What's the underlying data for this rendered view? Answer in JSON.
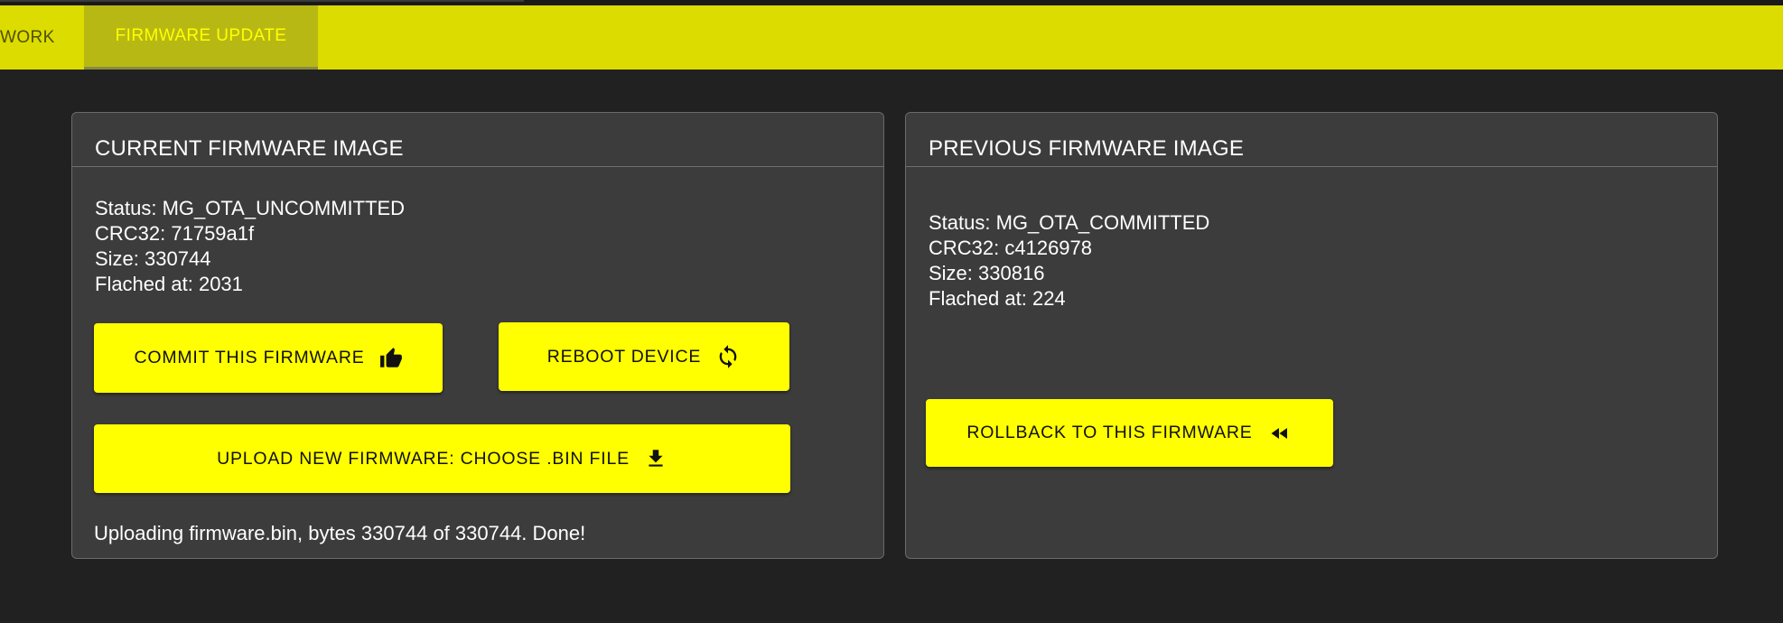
{
  "tabs": [
    {
      "label": "WORK"
    },
    {
      "label": "FIRMWARE UPDATE",
      "active": true
    }
  ],
  "current": {
    "title": "CURRENT FIRMWARE IMAGE",
    "status": "Status: MG_OTA_UNCOMMITTED",
    "crc32": "CRC32: 71759a1f",
    "size": "Size: 330744",
    "flashed_at": "Flached at: 2031",
    "commit_label": "COMMIT THIS FIRMWARE",
    "reboot_label": "REBOOT DEVICE",
    "upload_label": "UPLOAD NEW FIRMWARE: CHOOSE .BIN FILE",
    "upload_status": "Uploading firmware.bin, bytes 330744 of 330744. Done!"
  },
  "previous": {
    "title": "PREVIOUS FIRMWARE IMAGE",
    "status": "Status: MG_OTA_COMMITTED",
    "crc32": "CRC32: c4126978",
    "size": "Size: 330816",
    "flashed_at": "Flached at: 224",
    "rollback_label": "ROLLBACK TO THIS FIRMWARE"
  },
  "colors": {
    "accent": "#ffff00",
    "tabbar": "#dcdc00",
    "background": "#212121",
    "card": "#3c3c3c"
  },
  "icons": {
    "commit": "thumbs-up-icon",
    "reboot": "refresh-icon",
    "upload": "download-icon",
    "rollback": "rewind-icon"
  }
}
